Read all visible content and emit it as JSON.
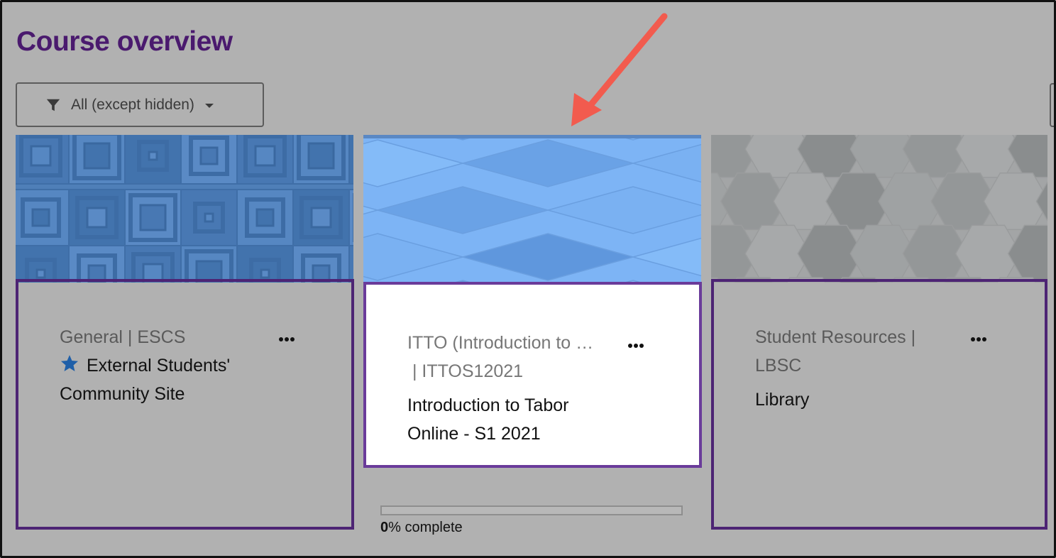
{
  "page": {
    "title": "Course overview"
  },
  "filter": {
    "label": "All (except hidden)"
  },
  "courses": [
    {
      "category": "General | ESCS",
      "name": "External Students' Community Site",
      "starred": true
    },
    {
      "category_line1": "ITTO (Introduction to …",
      "category_line2": " | ITTOS12021",
      "name_line1": "Introduction to Tabor",
      "name_line2": "Online - S1 2021",
      "starred": false,
      "progress": {
        "value": 0,
        "value_text": "0",
        "suffix": "% complete"
      }
    },
    {
      "category_line1": "Student Resources |",
      "category_line2": "LBSC",
      "name": "Library",
      "starred": false
    }
  ],
  "icons": {
    "filter": "funnel-icon",
    "dropdown": "caret-down-icon",
    "favourite": "star-icon",
    "menu": "more-dots-icon",
    "annotation": "red-arrow"
  },
  "colors": {
    "title": "#4a1a6e",
    "card_border": "#4d2474",
    "active_card_border": "#6a3b9a",
    "star": "#1f5fa8",
    "arrow": "#f25b4e",
    "backdrop": "#b1b1b1"
  }
}
